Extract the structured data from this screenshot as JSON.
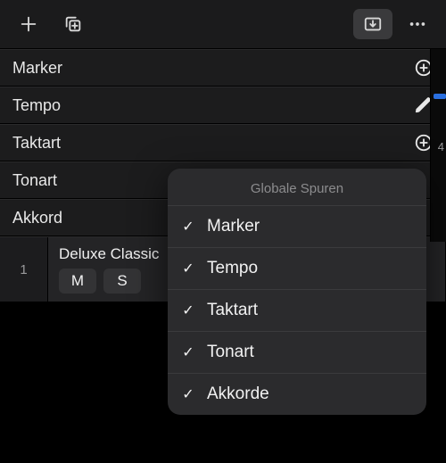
{
  "toolbar": {
    "add_icon": "plus",
    "add_copy_icon": "copy-plus",
    "download_icon": "tray-down",
    "more_icon": "dots"
  },
  "rows": [
    {
      "label": "Marker",
      "action": "plus"
    },
    {
      "label": "Tempo",
      "action": "pencil"
    },
    {
      "label": "Taktart",
      "action": "plus"
    },
    {
      "label": "Tonart",
      "action": ""
    },
    {
      "label": "Akkord",
      "action": ""
    }
  ],
  "track": {
    "index": "1",
    "name": "Deluxe Classic",
    "mute_label": "M",
    "solo_label": "S"
  },
  "rail": {
    "tick": "4"
  },
  "menu": {
    "header": "Globale Spuren",
    "items": [
      {
        "label": "Marker",
        "checked": true
      },
      {
        "label": "Tempo",
        "checked": true
      },
      {
        "label": "Taktart",
        "checked": true
      },
      {
        "label": "Tonart",
        "checked": true
      },
      {
        "label": "Akkorde",
        "checked": true
      }
    ]
  }
}
